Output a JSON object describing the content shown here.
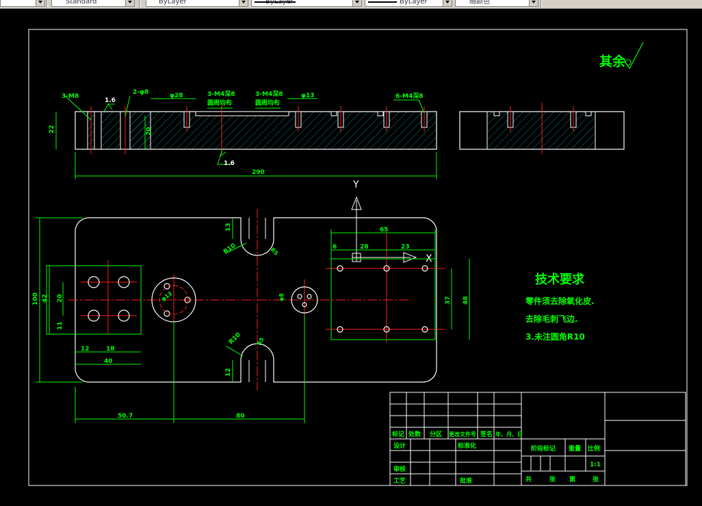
{
  "toolbar": {
    "combo1": "",
    "text_style": "Standard",
    "layer": "ByLayer",
    "linetype": "ByLayer",
    "lineweight": "ByLayer",
    "color": "随颜色"
  },
  "drawing": {
    "roughness_note": "其余",
    "tech_title": "技术要求",
    "tech_lines": [
      "零件须去除氧化皮.",
      "去除毛刺飞边.",
      "3.未注圆角R10"
    ],
    "callouts": {
      "m8": "3-M8",
      "phi8": "2-φ8",
      "phi28": "φ28",
      "m4_1": "3-M4深8",
      "uniform1": "圆周均布",
      "m4_2": "3-M4深8",
      "uniform2": "圆周均布",
      "phi13": "φ13",
      "m4_3": "6-M4深8"
    },
    "dims": {
      "rough_a": "1.6",
      "rough_b": "1.6",
      "h22": "22",
      "h20": "20",
      "len290": "290",
      "w65": "65",
      "d6": "6",
      "d28": "28",
      "d23": "23",
      "h37": "37",
      "h48": "48",
      "h100": "100",
      "h42": "42",
      "h20b": "20",
      "h11": "11",
      "w12": "12",
      "w18": "18",
      "w40": "40",
      "w50_7": "50.7",
      "w80": "80",
      "r10a": "R10",
      "r10b": "R10",
      "r5a": "R5",
      "r5b": "R5",
      "h13": "13",
      "h12": "12",
      "phi13b": "φ13",
      "phi8b": "φ8"
    },
    "ucs": {
      "x": "X",
      "y": "Y"
    }
  },
  "title_block": {
    "headers": [
      "标记",
      "处数",
      "分区",
      "更改文件号",
      "签名",
      "年、月、日"
    ],
    "design": "设计",
    "standardize": "标准化",
    "review": "审核",
    "process": "工艺",
    "approve": "批准",
    "stage_mark": "阶段标记",
    "weight": "重量",
    "scale": "比例",
    "scale_value": "1:1",
    "total": "共",
    "sheets": "张",
    "page": "第",
    "sheet": "张"
  }
}
